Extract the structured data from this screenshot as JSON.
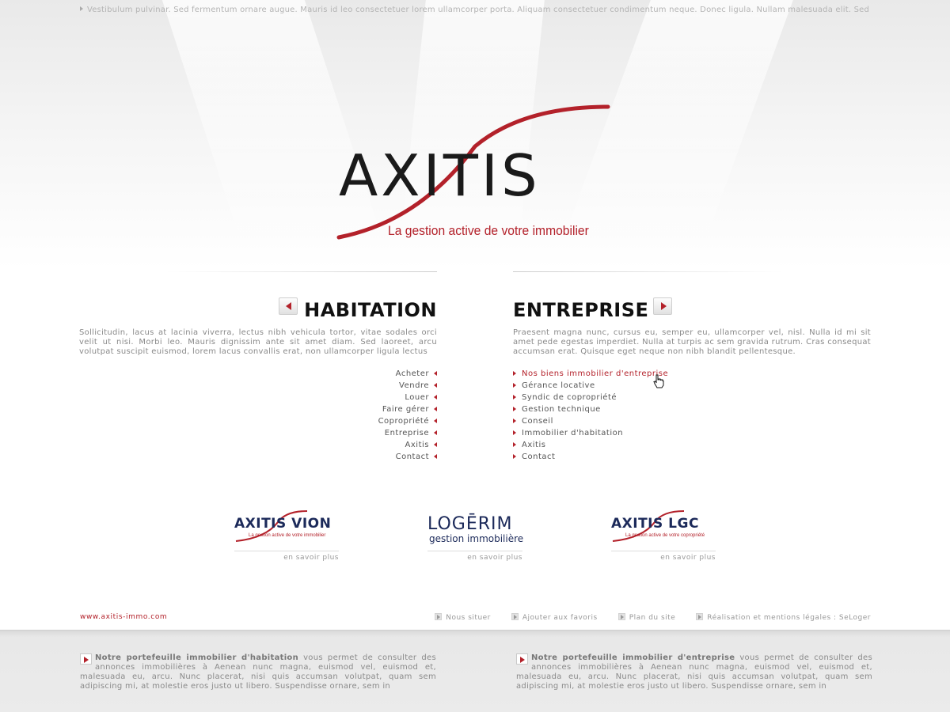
{
  "ticker": "Vestibulum pulvinar. Sed fermentum ornare augue. Mauris id leo consectetuer lorem ullamcorper porta. Aliquam consectetuer condimentum neque. Donec ligula. Nullam malesuada elit. Sed dictum,",
  "logo": {
    "name": "AXITIS",
    "tagline": "La gestion active de votre immobilier"
  },
  "habitation": {
    "title": "HABITATION",
    "text": "Sollicitudin, lacus at lacinia viverra, lectus nibh vehicula tortor, vitae sodales orci velit ut nisi. Morbi leo. Mauris dignissim ante sit amet diam. Sed laoreet, arcu volutpat suscipit euismod, lorem lacus convallis erat, non ullamcorper ligula lectus",
    "menu": [
      "Acheter",
      "Vendre",
      "Louer",
      "Faire gérer",
      "Copropriété",
      "Entreprise",
      "Axitis",
      "Contact"
    ]
  },
  "entreprise": {
    "title": "ENTREPRISE",
    "text": "Praesent magna nunc, cursus eu, semper eu, ullamcorper vel, nisl. Nulla id mi sit amet pede egestas imperdiet. Nulla at turpis ac sem gravida rutrum. Cras consequat accumsan erat. Quisque eget neque non nibh blandit pellentesque.",
    "menu": [
      "Nos biens immobilier d'entreprise",
      "Gérance locative",
      "Syndic de copropriété",
      "Gestion technique",
      "Conseil",
      "Immobilier d'habitation",
      "Axitis",
      "Contact"
    ],
    "active_index": 0
  },
  "brands": [
    {
      "name": "AXITIS VION",
      "sub": "La gestion active de votre immobilier",
      "more": "en savoir plus"
    },
    {
      "name": "LOGĒRIM",
      "sub": "gestion immobilière",
      "more": "en savoir plus"
    },
    {
      "name": "AXITIS LGC",
      "sub": "La gestion active de votre copropriété",
      "more": "en savoir plus"
    }
  ],
  "footer": {
    "url": "www.axitis-immo.com",
    "links": [
      "Nous situer",
      "Ajouter aux favoris",
      "Plan du site",
      "Réalisation et mentions légales : SeLoger"
    ]
  },
  "bottom": {
    "left": {
      "bold": "Notre portefeuille immobilier d'habitation",
      "text": " vous permet de consulter des annonces immobilières à Aenean nunc magna, euismod vel, euismod et, malesuada eu, arcu. Nunc placerat, nisi quis accumsan volutpat, quam sem adipiscing mi, at molestie eros justo ut libero. Suspendisse ornare, sem in"
    },
    "right": {
      "bold": "Notre portefeuille immobilier d'entreprise",
      "text": " vous permet de consulter des annonces immobilières à Aenean nunc magna, euismod vel, euismod et, malesuada eu, arcu. Nunc placerat, nisi quis accumsan volutpat, quam sem adipiscing mi, at molestie eros justo ut libero. Suspendisse ornare, sem in"
    }
  },
  "colors": {
    "accent": "#b3212a",
    "navy": "#1c2a5a",
    "text": "#8a8a8a"
  }
}
